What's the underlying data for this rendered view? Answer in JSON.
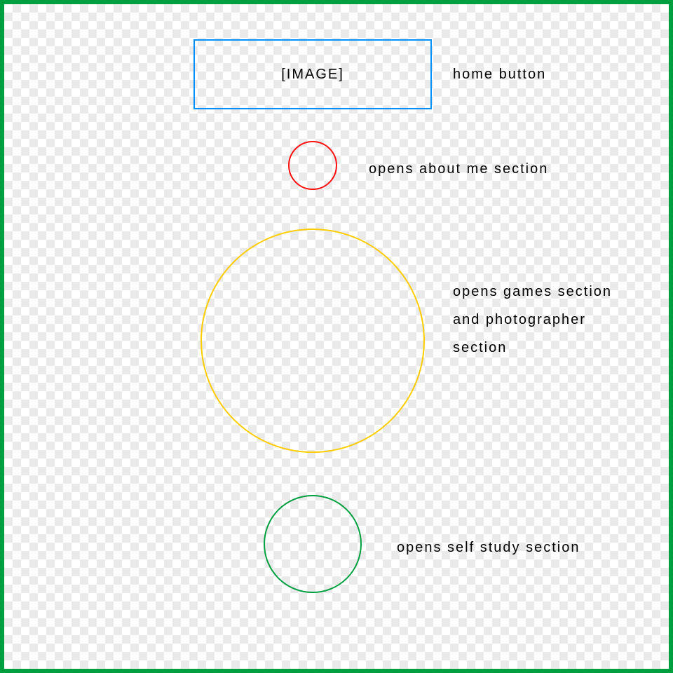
{
  "annotations": {
    "home": {
      "placeholder": "[IMAGE]",
      "label": "home button"
    },
    "red": {
      "label": "opens about me section"
    },
    "yellow": {
      "label": "opens games section and photographer section"
    },
    "green": {
      "label": "opens self study section"
    }
  }
}
